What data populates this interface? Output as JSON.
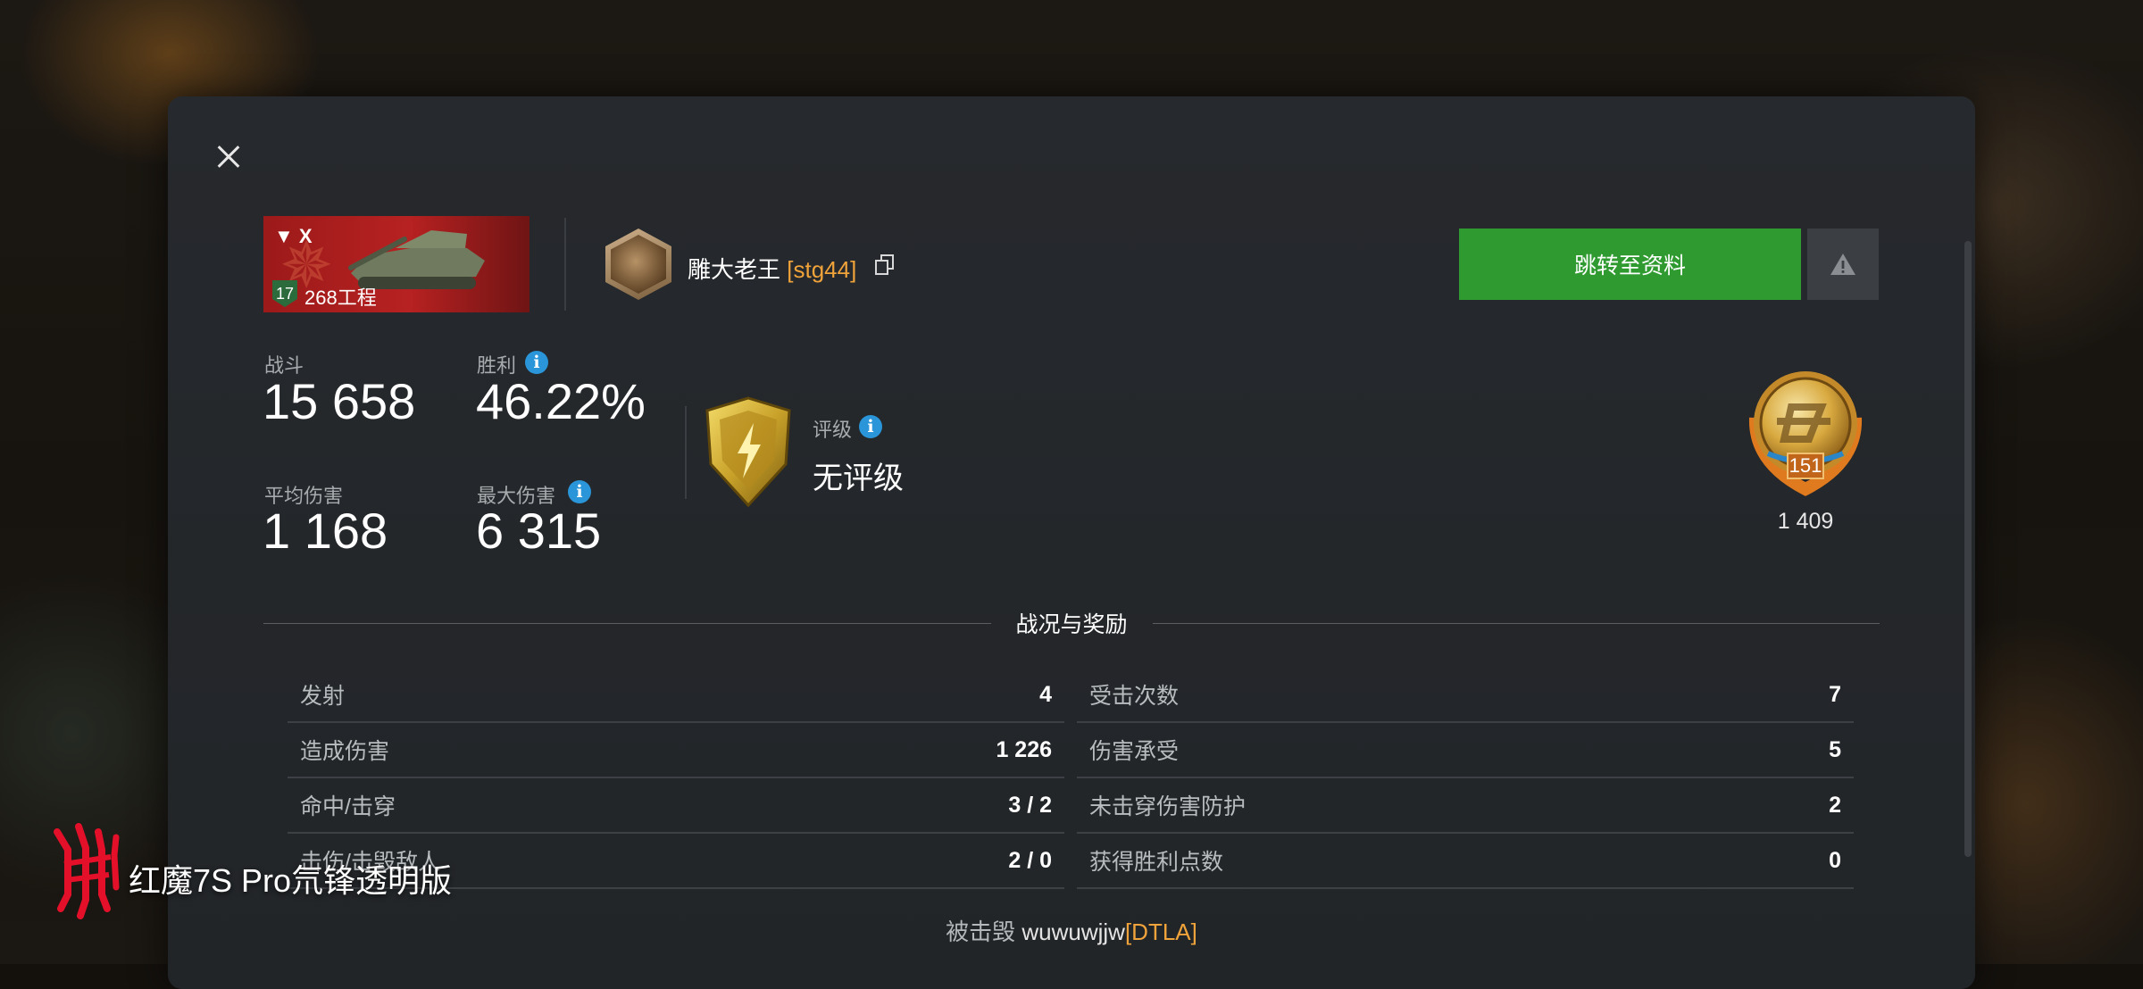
{
  "header": {
    "close_label": "✕",
    "tank": {
      "tier": "▼ X",
      "level": "17",
      "name": "268工程"
    },
    "player": {
      "name": "雕大老王",
      "clan": "[stg44]"
    },
    "profile_button": "跳转至资料",
    "report_icon": "warning-icon"
  },
  "stats": {
    "battles": {
      "label": "战斗",
      "value": "15 658"
    },
    "wins": {
      "label": "胜利",
      "value": "46.22%"
    },
    "avg_damage": {
      "label": "平均伤害",
      "value": "1 168"
    },
    "max_damage": {
      "label": "最大伤害",
      "value": "6 315"
    },
    "rating": {
      "label": "评级",
      "value": "无评级"
    },
    "medal": {
      "level": "151",
      "count": "1 409"
    }
  },
  "section": {
    "title": "战况与奖励",
    "left": [
      {
        "label": "发射",
        "value": "4"
      },
      {
        "label": "造成伤害",
        "value": "1 226"
      },
      {
        "label": "命中/击穿",
        "value": "3 / 2"
      },
      {
        "label": "击伤/击毁敌人",
        "value": "2 / 0"
      }
    ],
    "right": [
      {
        "label": "受击次数",
        "value": "7"
      },
      {
        "label": "伤害承受",
        "value": "5"
      },
      {
        "label": "未击穿伤害防护",
        "value": "2"
      },
      {
        "label": "获得胜利点数",
        "value": "0"
      }
    ]
  },
  "footer": {
    "destroyed_by_label": "被击毁",
    "destroyed_by_name": "wuwuwjjw",
    "destroyed_by_clan": "[DTLA]"
  },
  "watermark": {
    "text": "红魔7S Pro氘锋透明版"
  },
  "colors": {
    "accent_green": "#2e9a2f",
    "clan_orange": "#f0a33a",
    "info_blue": "#2a95d8",
    "brand_red": "#e4102a"
  }
}
